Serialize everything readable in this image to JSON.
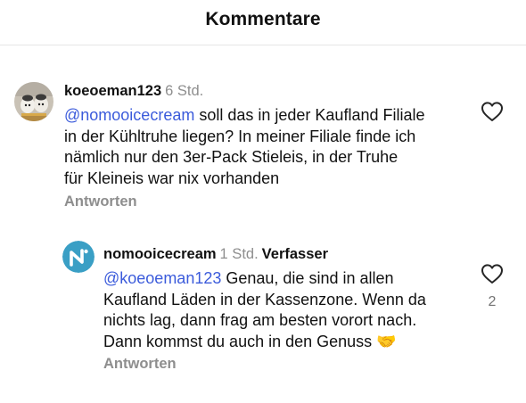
{
  "header": {
    "title": "Kommentare"
  },
  "comments": [
    {
      "username": "koeoeman123",
      "time": "6 Std.",
      "mention": "@nomooicecream",
      "text_lines": [
        " soll das in jeder Kaufland Filiale",
        "in der Kühltruhe liegen? In meiner Filiale finde ich",
        "nämlich nur den 3er-Pack Stieleis, in der Truhe",
        "für Kleineis war nix vorhanden"
      ],
      "reply_label": "Antworten",
      "like_icon": "heart-outline-icon"
    }
  ],
  "replies": [
    {
      "username": "nomooicecream",
      "time": "1 Std.",
      "badge": "Verfasser",
      "mention": "@koeoeman123",
      "text_lines": [
        " Genau, die sind in allen",
        "Kaufland Läden in der Kassenzone. Wenn da",
        "nichts lag, dann frag am besten vorort nach.",
        "Dann kommst du auch in den Genuss "
      ],
      "emoji": "🤝",
      "reply_label": "Antworten",
      "like_icon": "heart-outline-icon",
      "like_count": "2"
    }
  ],
  "colors": {
    "mention": "#3b5bdb",
    "muted": "#8e8e8e",
    "avatar_brand": "#3a9fc5"
  }
}
